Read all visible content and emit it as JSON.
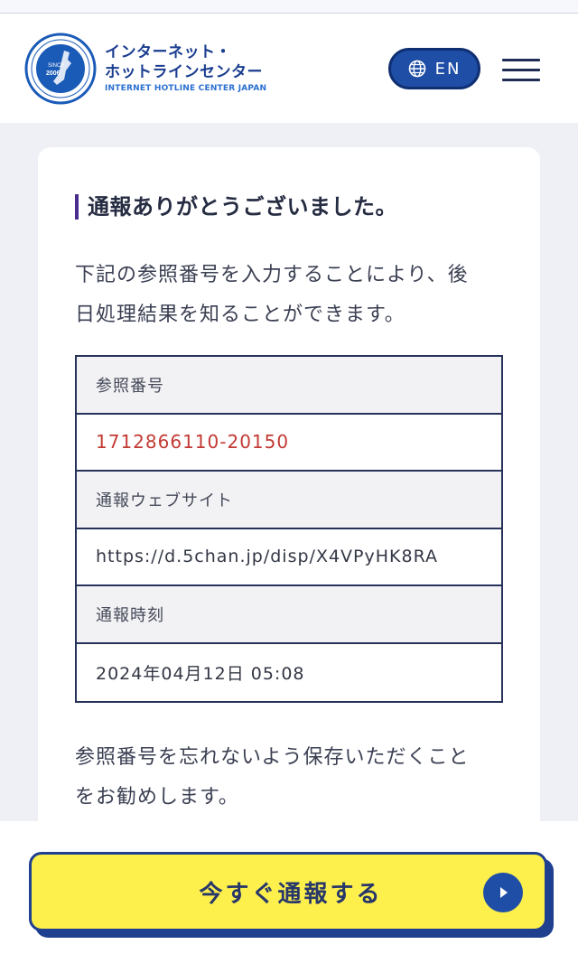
{
  "header": {
    "logo_seal_text_top": "INTERNET HOTLINE CENTER JAPAN",
    "logo_seal_since": "SINCE",
    "logo_seal_year": "2006",
    "logo_ja_line1": "インターネット・",
    "logo_ja_line2": "ホットラインセンター",
    "logo_en": "INTERNET HOTLINE CENTER JAPAN",
    "lang_label": "EN",
    "icons": {
      "language": "globe-icon",
      "menu": "hamburger-menu-icon"
    }
  },
  "card": {
    "heading": "通報ありがとうございました。",
    "desc_line1": "下記の参照番号を入力することにより、後",
    "desc_line2": "日処理結果を知ることができます。",
    "table": {
      "ref_label": "参照番号",
      "ref_value": "1712866110-20150",
      "site_label": "通報ウェブサイト",
      "site_value": "https://d.5chan.jp/disp/X4VPyHK8RA",
      "time_label": "通報時刻",
      "time_value": "2024年04月12日 05:08"
    },
    "note_line1": "参照番号を忘れないよう保存いただくこと",
    "note_line2": "をお勧めします。"
  },
  "cta": {
    "label": "今すぐ通報する",
    "icon": "play-arrow-icon"
  },
  "colors": {
    "brand_blue": "#1f4ea6",
    "accent_yellow": "#fdf04d",
    "ref_red": "#c23a34",
    "heading_bar": "#4a2c8f"
  }
}
